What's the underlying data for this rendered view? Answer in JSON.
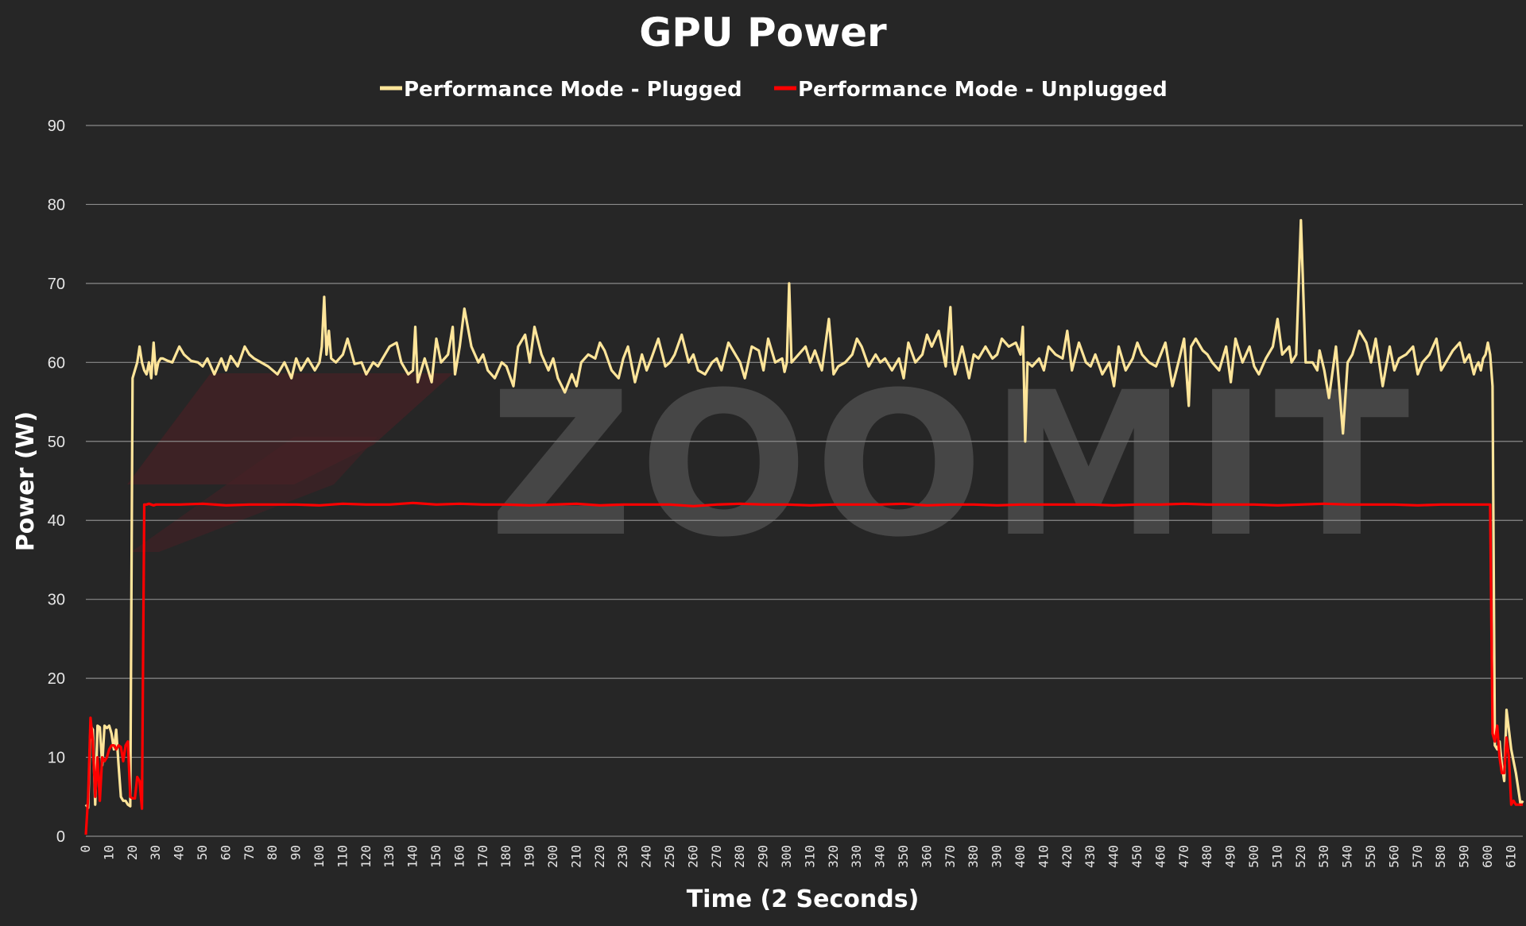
{
  "chart_data": {
    "type": "line",
    "title": "GPU Power",
    "xlabel": "Time (2 Seconds)",
    "ylabel": "Power (W)",
    "xlim": [
      0,
      615
    ],
    "ylim": [
      0,
      90
    ],
    "yticks": [
      0,
      10,
      20,
      30,
      40,
      50,
      60,
      70,
      80,
      90
    ],
    "xticks": [
      0,
      10,
      20,
      30,
      40,
      50,
      60,
      70,
      80,
      90,
      100,
      110,
      120,
      130,
      140,
      150,
      160,
      170,
      180,
      190,
      200,
      210,
      220,
      230,
      240,
      250,
      260,
      270,
      280,
      290,
      300,
      310,
      320,
      330,
      340,
      350,
      360,
      370,
      380,
      390,
      400,
      410,
      420,
      430,
      440,
      450,
      460,
      470,
      480,
      490,
      500,
      510,
      520,
      530,
      540,
      550,
      560,
      570,
      580,
      590,
      600,
      610
    ],
    "grid": true,
    "legend_position": "top-center",
    "watermark": "ZOOMIT",
    "series": [
      {
        "name": "Performance Mode - Plugged",
        "color": "#ffe59a",
        "x": [
          0,
          1,
          2,
          3,
          4,
          5,
          6,
          7,
          8,
          9,
          10,
          11,
          12,
          13,
          14,
          15,
          16,
          17,
          18,
          19,
          20,
          21,
          22,
          23,
          24,
          25,
          26,
          27,
          28,
          29,
          30,
          31,
          32,
          33,
          35,
          37,
          40,
          42,
          45,
          48,
          50,
          52,
          55,
          58,
          60,
          62,
          65,
          68,
          70,
          72,
          75,
          78,
          80,
          82,
          85,
          88,
          90,
          92,
          95,
          98,
          100,
          101,
          102,
          103,
          104,
          105,
          107,
          110,
          112,
          115,
          118,
          120,
          123,
          125,
          128,
          130,
          133,
          135,
          138,
          140,
          141,
          142,
          145,
          148,
          150,
          152,
          155,
          157,
          158,
          160,
          162,
          165,
          168,
          170,
          172,
          175,
          178,
          180,
          183,
          185,
          188,
          190,
          192,
          195,
          198,
          200,
          202,
          205,
          208,
          210,
          212,
          215,
          218,
          220,
          222,
          225,
          228,
          230,
          232,
          235,
          238,
          240,
          242,
          245,
          248,
          250,
          252,
          255,
          258,
          260,
          262,
          265,
          268,
          270,
          272,
          275,
          278,
          280,
          282,
          285,
          288,
          290,
          292,
          295,
          298,
          299,
          300,
          301,
          302,
          305,
          308,
          310,
          312,
          315,
          318,
          320,
          322,
          325,
          328,
          330,
          332,
          335,
          338,
          340,
          342,
          345,
          348,
          350,
          352,
          355,
          358,
          360,
          362,
          365,
          368,
          370,
          371,
          372,
          375,
          378,
          380,
          382,
          385,
          388,
          390,
          392,
          395,
          398,
          400,
          401,
          402,
          403,
          405,
          408,
          410,
          412,
          415,
          418,
          420,
          422,
          425,
          428,
          430,
          432,
          435,
          438,
          440,
          442,
          445,
          448,
          450,
          452,
          455,
          458,
          460,
          462,
          465,
          468,
          470,
          472,
          473,
          475,
          478,
          480,
          482,
          485,
          488,
          490,
          492,
          495,
          498,
          500,
          502,
          505,
          508,
          510,
          512,
          515,
          516,
          517,
          518,
          520,
          522,
          525,
          527,
          528,
          530,
          532,
          535,
          538,
          540,
          542,
          545,
          548,
          550,
          552,
          555,
          558,
          560,
          562,
          565,
          568,
          570,
          572,
          575,
          578,
          580,
          582,
          585,
          588,
          590,
          592,
          594,
          595,
          596,
          597,
          598,
          599,
          600,
          601,
          602,
          603,
          604,
          605,
          606,
          607,
          608,
          610,
          612,
          614,
          615
        ],
        "y": [
          4,
          3.6,
          14,
          13.5,
          4,
          14,
          13.8,
          9,
          14,
          13.7,
          14,
          13,
          11,
          13.5,
          9,
          5,
          4.5,
          4.5,
          4,
          3.8,
          58,
          59,
          60,
          62,
          60,
          59,
          58.5,
          60,
          58,
          62.5,
          58.5,
          60,
          60.5,
          60.5,
          60.2,
          60,
          62,
          61,
          60.2,
          60,
          59.5,
          60.5,
          58.5,
          60.5,
          59,
          60.8,
          59.5,
          62,
          61,
          60.5,
          60,
          59.5,
          59,
          58.5,
          60,
          58,
          60.5,
          59,
          60.5,
          59,
          60,
          62,
          68.3,
          61,
          64,
          60.5,
          60,
          61,
          63,
          59.8,
          60,
          58.5,
          60,
          59.5,
          61,
          62,
          62.5,
          60,
          58.5,
          59,
          64.5,
          57.5,
          60.5,
          57.5,
          63,
          60,
          61,
          64.5,
          58.5,
          62,
          66.8,
          62,
          60,
          61,
          59,
          58,
          60,
          59.5,
          57,
          62,
          63.5,
          60,
          64.5,
          61,
          59,
          60.5,
          58,
          56.2,
          58.5,
          57,
          60,
          61,
          60.5,
          62.5,
          61.5,
          59,
          58,
          60.5,
          62,
          57.5,
          61,
          59,
          60.5,
          63,
          59.5,
          60,
          61,
          63.5,
          60,
          61,
          59,
          58.5,
          60,
          60.5,
          59,
          62.5,
          61,
          60,
          58,
          62,
          61.5,
          59,
          63,
          60,
          60.5,
          58.8,
          60,
          70,
          60,
          61,
          62,
          60,
          61.5,
          59,
          65.5,
          58.5,
          59.5,
          60,
          61,
          63,
          62,
          59.5,
          61,
          60,
          60.5,
          59,
          60.5,
          58,
          62.5,
          60,
          61,
          63.5,
          62,
          64,
          59.5,
          67,
          60,
          58.5,
          62,
          58,
          61,
          60.5,
          62,
          60.5,
          61,
          63,
          62,
          62.5,
          61,
          64.5,
          50,
          60,
          59.5,
          60.5,
          59,
          62,
          61,
          60.5,
          64,
          59,
          62.5,
          60,
          59.5,
          61,
          58.5,
          60,
          57,
          62,
          59,
          60.5,
          62.5,
          61,
          60,
          59.5,
          61,
          62.5,
          57,
          60.5,
          63,
          54.5,
          62,
          63,
          61.5,
          61,
          60,
          59,
          62,
          57.5,
          63,
          60,
          62,
          59.5,
          58.5,
          60.5,
          62,
          65.5,
          61,
          62,
          60,
          60.5,
          61,
          78,
          60,
          60,
          59,
          61.5,
          59,
          55.5,
          62,
          51,
          60,
          61,
          64,
          62.5,
          60,
          63,
          57,
          62,
          59,
          60.5,
          61,
          62,
          58.5,
          60,
          61,
          63,
          59,
          60,
          61.5,
          62.5,
          60,
          61,
          58.5,
          59.5,
          60,
          59,
          60.5,
          61,
          62.5,
          61,
          57,
          11.5,
          11,
          12,
          9,
          7,
          16,
          11,
          8,
          4,
          4.5,
          4.5,
          4.5,
          4.6,
          4.7,
          5,
          4.5
        ]
      },
      {
        "name": "Performance Mode - Unplugged",
        "color": "#ff0000",
        "x": [
          0,
          1,
          2,
          3,
          4,
          5,
          6,
          7,
          8,
          9,
          10,
          11,
          12,
          13,
          14,
          15,
          16,
          17,
          18,
          19,
          20,
          21,
          22,
          23,
          24,
          25,
          26,
          27,
          28,
          29,
          30,
          40,
          50,
          60,
          70,
          80,
          90,
          100,
          110,
          120,
          130,
          140,
          150,
          160,
          170,
          180,
          190,
          200,
          210,
          220,
          230,
          240,
          250,
          260,
          270,
          280,
          290,
          300,
          310,
          320,
          330,
          340,
          350,
          360,
          370,
          380,
          390,
          400,
          410,
          420,
          430,
          440,
          450,
          460,
          470,
          480,
          490,
          500,
          510,
          520,
          530,
          540,
          550,
          560,
          570,
          580,
          590,
          600,
          601,
          602,
          603,
          604,
          605,
          606,
          607,
          608,
          609,
          610,
          611,
          612,
          613,
          614,
          615
        ],
        "y": [
          0.2,
          5,
          15,
          12,
          5,
          10,
          4.5,
          10,
          9.5,
          10,
          11,
          11.5,
          11.5,
          11,
          11.5,
          11.3,
          9.5,
          11.5,
          12,
          5,
          4.8,
          4.8,
          7.5,
          7,
          3.5,
          42,
          42,
          42.1,
          42,
          41.9,
          42,
          42,
          42.1,
          41.9,
          42,
          42,
          42,
          41.9,
          42.1,
          42,
          42,
          42.2,
          42,
          42.1,
          42,
          42,
          41.9,
          42,
          42.1,
          41.9,
          42,
          42,
          42,
          41.8,
          42,
          42.1,
          42,
          42,
          41.9,
          42,
          42,
          42,
          42.1,
          41.9,
          42,
          42,
          41.9,
          42,
          42,
          42,
          42,
          41.9,
          42,
          42,
          42.1,
          42,
          42,
          42,
          41.9,
          42,
          42.1,
          42,
          42,
          42,
          41.9,
          42,
          42,
          42,
          42,
          13,
          12,
          14,
          10,
          8,
          8,
          12.5,
          10,
          4,
          4.5,
          4,
          4,
          4,
          4
        ]
      }
    ]
  }
}
